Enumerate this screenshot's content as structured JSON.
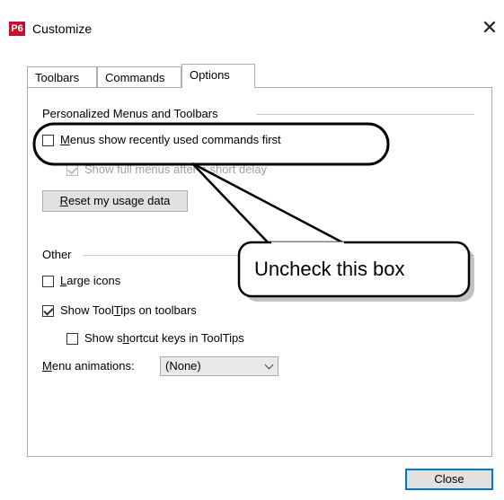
{
  "window": {
    "app_icon_text": "P6",
    "title": "Customize",
    "close_glyph": "✕"
  },
  "tabs": [
    {
      "label": "Toolbars",
      "active": false
    },
    {
      "label": "Commands",
      "active": false
    },
    {
      "label": "Options",
      "active": true
    }
  ],
  "options": {
    "group1_label": "Personalized Menus and Toolbars",
    "recent_first": {
      "pre": "",
      "ul": "M",
      "post": "enus show recently used commands first",
      "checked": false
    },
    "full_menus": {
      "label": "Show full menus after a short delay",
      "checked": true,
      "disabled": true
    },
    "reset_button": {
      "pre": "",
      "ul": "R",
      "post": "eset my usage data"
    },
    "group2_label": "Other",
    "large_icons": {
      "pre": "",
      "ul": "L",
      "post": "arge icons",
      "checked": false
    },
    "show_tooltips": {
      "pre": "Show Tool",
      "ul": "T",
      "post": "ips on toolbars",
      "checked": true
    },
    "shortcut_keys": {
      "pre": "Show s",
      "ul": "h",
      "post": "ortcut keys in ToolTips",
      "checked": false
    },
    "menu_anim": {
      "pre": "",
      "ul": "M",
      "post": "enu animations:",
      "value": "(None)"
    }
  },
  "footer": {
    "close_label": "Close"
  },
  "callout": {
    "text": "Uncheck this box"
  },
  "colors": {
    "accent": "#0078d7",
    "app_icon": "#c8102e"
  }
}
